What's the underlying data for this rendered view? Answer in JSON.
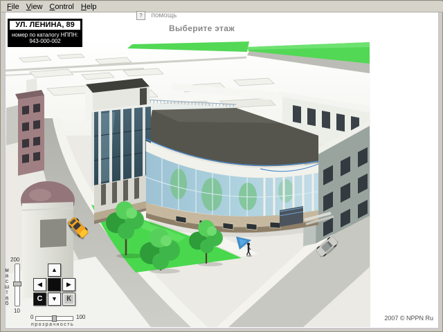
{
  "menu": {
    "items": [
      {
        "accel": "F",
        "rest": "ile"
      },
      {
        "accel": "V",
        "rest": "iew"
      },
      {
        "accel": "C",
        "rest": "ontrol"
      },
      {
        "accel": "H",
        "rest": "elp"
      }
    ]
  },
  "address_box": {
    "street": "УЛ. ЛЕНИНА, 89",
    "catalog_label": "номер по каталогу НППН:",
    "catalog_number": "943-000-002"
  },
  "help_button": {
    "icon": "?",
    "label": "помощь"
  },
  "heading": "Выберите этаж",
  "controls": {
    "scale": {
      "label_vertical": "м\nа\nс\nш\nт\nа\nб",
      "max": "200",
      "min": "10"
    },
    "dpad": {
      "up": "▲",
      "left": "◀",
      "right": "▶",
      "down": "▼",
      "c": "C",
      "k": "К"
    },
    "transparency": {
      "min": "0",
      "max": "100",
      "label": "прозрачность"
    }
  },
  "footer": {
    "copyright": "2007 © NPPN Ru"
  },
  "colors": {
    "lawn_green": "#49d84d",
    "field_green": "#52d855",
    "glass_blue": "#a9cede",
    "tower_glass": "#3f5d6d",
    "taxi_yellow": "#f2a51f",
    "railing_blue": "#4e8ed0",
    "roof_dark": "#55554d",
    "base_tan": "#c6b89e",
    "dome_mauve": "#94767a"
  }
}
